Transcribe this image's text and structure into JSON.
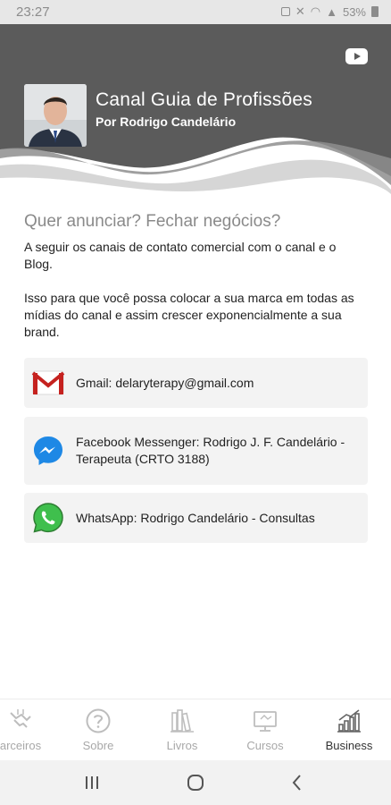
{
  "status_bar": {
    "time": "23:27",
    "battery": "53%"
  },
  "header": {
    "title": "Canal Guia de Profissões",
    "subtitle": "Por Rodrigo Candelário",
    "youtube_icon": "youtube-icon",
    "bg_color": "#5b5b5b"
  },
  "content": {
    "heading": "Quer anunciar? Fechar negócios?",
    "paragraph1": "A seguir os canais de contato comercial com o canal e o Blog.",
    "paragraph2": "Isso para que você possa colocar a sua marca em todas as mídias do canal e assim crescer exponencialmente a sua brand."
  },
  "contacts": [
    {
      "icon": "gmail-icon",
      "label": "Gmail: delaryterapy@gmail.com"
    },
    {
      "icon": "messenger-icon",
      "label": "Facebook Messenger: Rodrigo J. F. Candelário - Terapeuta (CRTO 3188)"
    },
    {
      "icon": "whatsapp-icon",
      "label": "WhatsApp: Rodrigo Candelário - Consultas"
    }
  ],
  "bottom_nav": {
    "items": [
      {
        "label": "arceiros",
        "icon": "handshake-icon",
        "active": false
      },
      {
        "label": "Sobre",
        "icon": "question-icon",
        "active": false
      },
      {
        "label": "Livros",
        "icon": "books-icon",
        "active": false
      },
      {
        "label": "Cursos",
        "icon": "monitor-icon",
        "active": false
      },
      {
        "label": "Business",
        "icon": "bar-chart-icon",
        "active": true
      }
    ]
  },
  "colors": {
    "accent_text": "#8a8a8a",
    "active_nav": "#333333",
    "inactive_nav": "#a8a8a8",
    "card_bg": "#f3f3f3"
  }
}
